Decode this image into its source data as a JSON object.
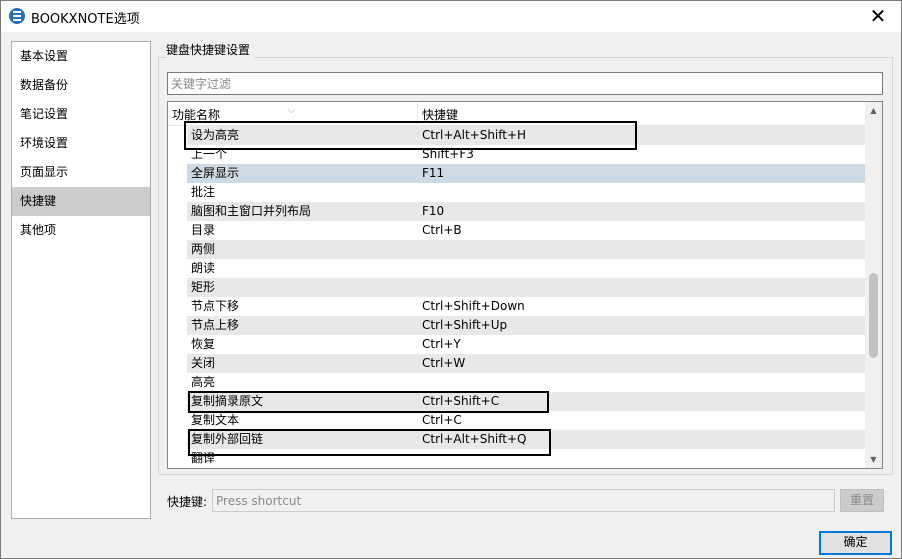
{
  "window": {
    "title": "BOOKXNOTE选项",
    "close_glyph": "✕",
    "icon": "bookxnote-app-icon"
  },
  "sidebar": {
    "items": [
      {
        "label": "基本设置"
      },
      {
        "label": "数据备份"
      },
      {
        "label": "笔记设置"
      },
      {
        "label": "环境设置"
      },
      {
        "label": "页面显示"
      },
      {
        "label": "快捷键",
        "active": true
      },
      {
        "label": "其他项"
      }
    ]
  },
  "shortcuts_panel": {
    "group_label": "键盘快捷键设置",
    "filter": {
      "placeholder": "关键字过滤",
      "value": ""
    },
    "columns": {
      "name": "功能名称",
      "key": "快捷键"
    },
    "rows": [
      {
        "name": "设为高亮",
        "key": "Ctrl+Alt+Shift+H"
      },
      {
        "name": "上一个",
        "key": "Shift+F3"
      },
      {
        "name": "全屏显示",
        "key": "F11"
      },
      {
        "name": "批注",
        "key": ""
      },
      {
        "name": "脑图和主窗口并列布局",
        "key": "F10"
      },
      {
        "name": "目录",
        "key": "Ctrl+B"
      },
      {
        "name": "两侧",
        "key": ""
      },
      {
        "name": "朗读",
        "key": ""
      },
      {
        "name": "矩形",
        "key": ""
      },
      {
        "name": "节点下移",
        "key": "Ctrl+Shift+Down"
      },
      {
        "name": "节点上移",
        "key": "Ctrl+Shift+Up"
      },
      {
        "name": "恢复",
        "key": "Ctrl+Y"
      },
      {
        "name": "关闭",
        "key": "Ctrl+W"
      },
      {
        "name": "高亮",
        "key": ""
      },
      {
        "name": "复制摘录原文",
        "key": "Ctrl+Shift+C"
      },
      {
        "name": "复制文本",
        "key": "Ctrl+C"
      },
      {
        "name": "复制外部回链",
        "key": "Ctrl+Alt+Shift+Q"
      },
      {
        "name": "翻译",
        "key": ""
      }
    ],
    "selected_row": "全屏显示",
    "scroll_up_glyph": "▲",
    "scroll_down_glyph": "▼",
    "sort_glyph": "⌵"
  },
  "shortcut_editor": {
    "label": "快捷键:",
    "placeholder": "Press shortcut",
    "reset_label": "重置"
  },
  "footer": {
    "ok_label": "确定"
  },
  "colors": {
    "selected_row": "#cddae4",
    "alt_row": "#e9e8e6",
    "focus_border": "#0078d7",
    "highlight_box": "#000000"
  }
}
